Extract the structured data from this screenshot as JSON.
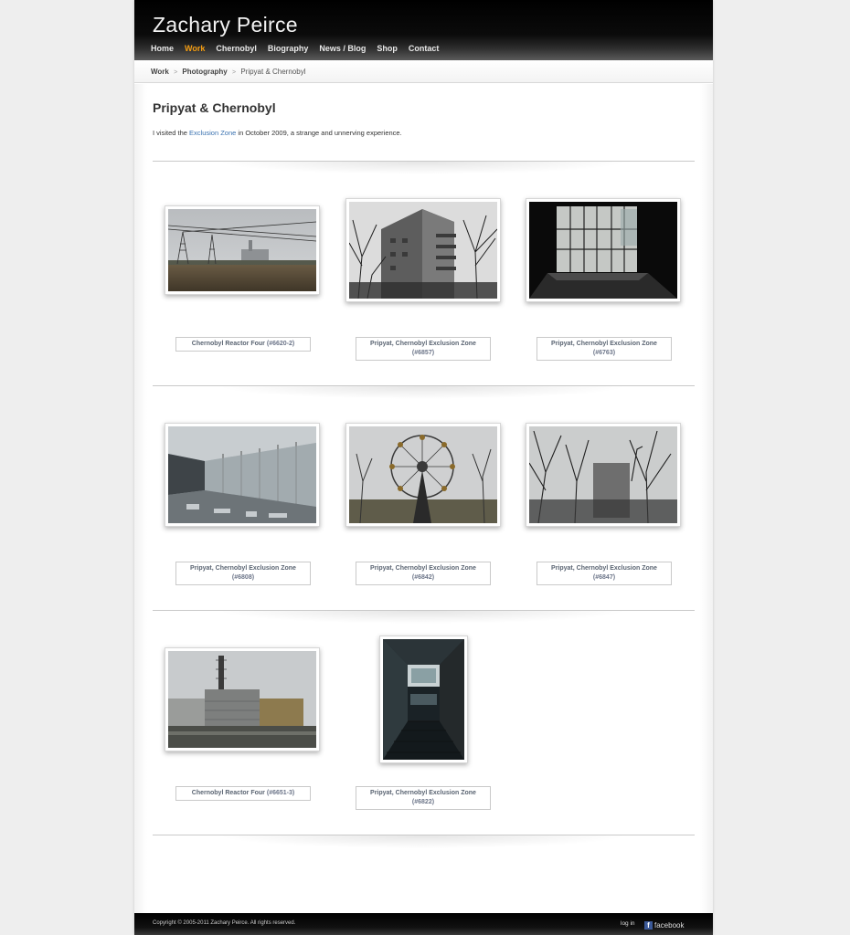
{
  "site": {
    "title": "Zachary Peirce"
  },
  "nav": [
    {
      "label": "Home",
      "active": false
    },
    {
      "label": "Work",
      "active": true
    },
    {
      "label": "Chernobyl",
      "active": false
    },
    {
      "label": "Biography",
      "active": false
    },
    {
      "label": "News / Blog",
      "active": false
    },
    {
      "label": "Shop",
      "active": false
    },
    {
      "label": "Contact",
      "active": false
    }
  ],
  "breadcrumb": {
    "items": [
      "Work",
      "Photography"
    ],
    "current": "Pripyat & Chernobyl",
    "separator": ">"
  },
  "main": {
    "title": "Pripyat & Chernobyl",
    "intro_before": "I visited the ",
    "intro_link": "Exclusion Zone",
    "intro_after": " in October 2009, a strange and unnerving experience."
  },
  "photos": [
    {
      "title": "Chernobyl Reactor Four",
      "number": "(#6620-2)"
    },
    {
      "title": "Pripyat, Chernobyl Exclusion Zone",
      "number": "(#6857)"
    },
    {
      "title": "Pripyat, Chernobyl Exclusion Zone",
      "number": "(#6763)"
    },
    {
      "title": "Pripyat, Chernobyl Exclusion Zone",
      "number": "(#6808)"
    },
    {
      "title": "Pripyat, Chernobyl Exclusion Zone",
      "number": "(#6842)"
    },
    {
      "title": "Pripyat, Chernobyl Exclusion Zone",
      "number": "(#6847)"
    },
    {
      "title": "Chernobyl Reactor Four",
      "number": "(#6651-3)"
    },
    {
      "title": "Pripyat, Chernobyl Exclusion Zone",
      "number": "(#6822)"
    }
  ],
  "footer": {
    "copyright": "Copyright © 2005-2011 Zachary Peirce. All rights reserved.",
    "login": "log in",
    "social_label": "facebook",
    "social_icon": "facebook-icon"
  },
  "colors": {
    "nav_active": "#f39c12",
    "link": "#3a72b0",
    "header_bg": "#000000",
    "facebook": "#3b5998"
  }
}
